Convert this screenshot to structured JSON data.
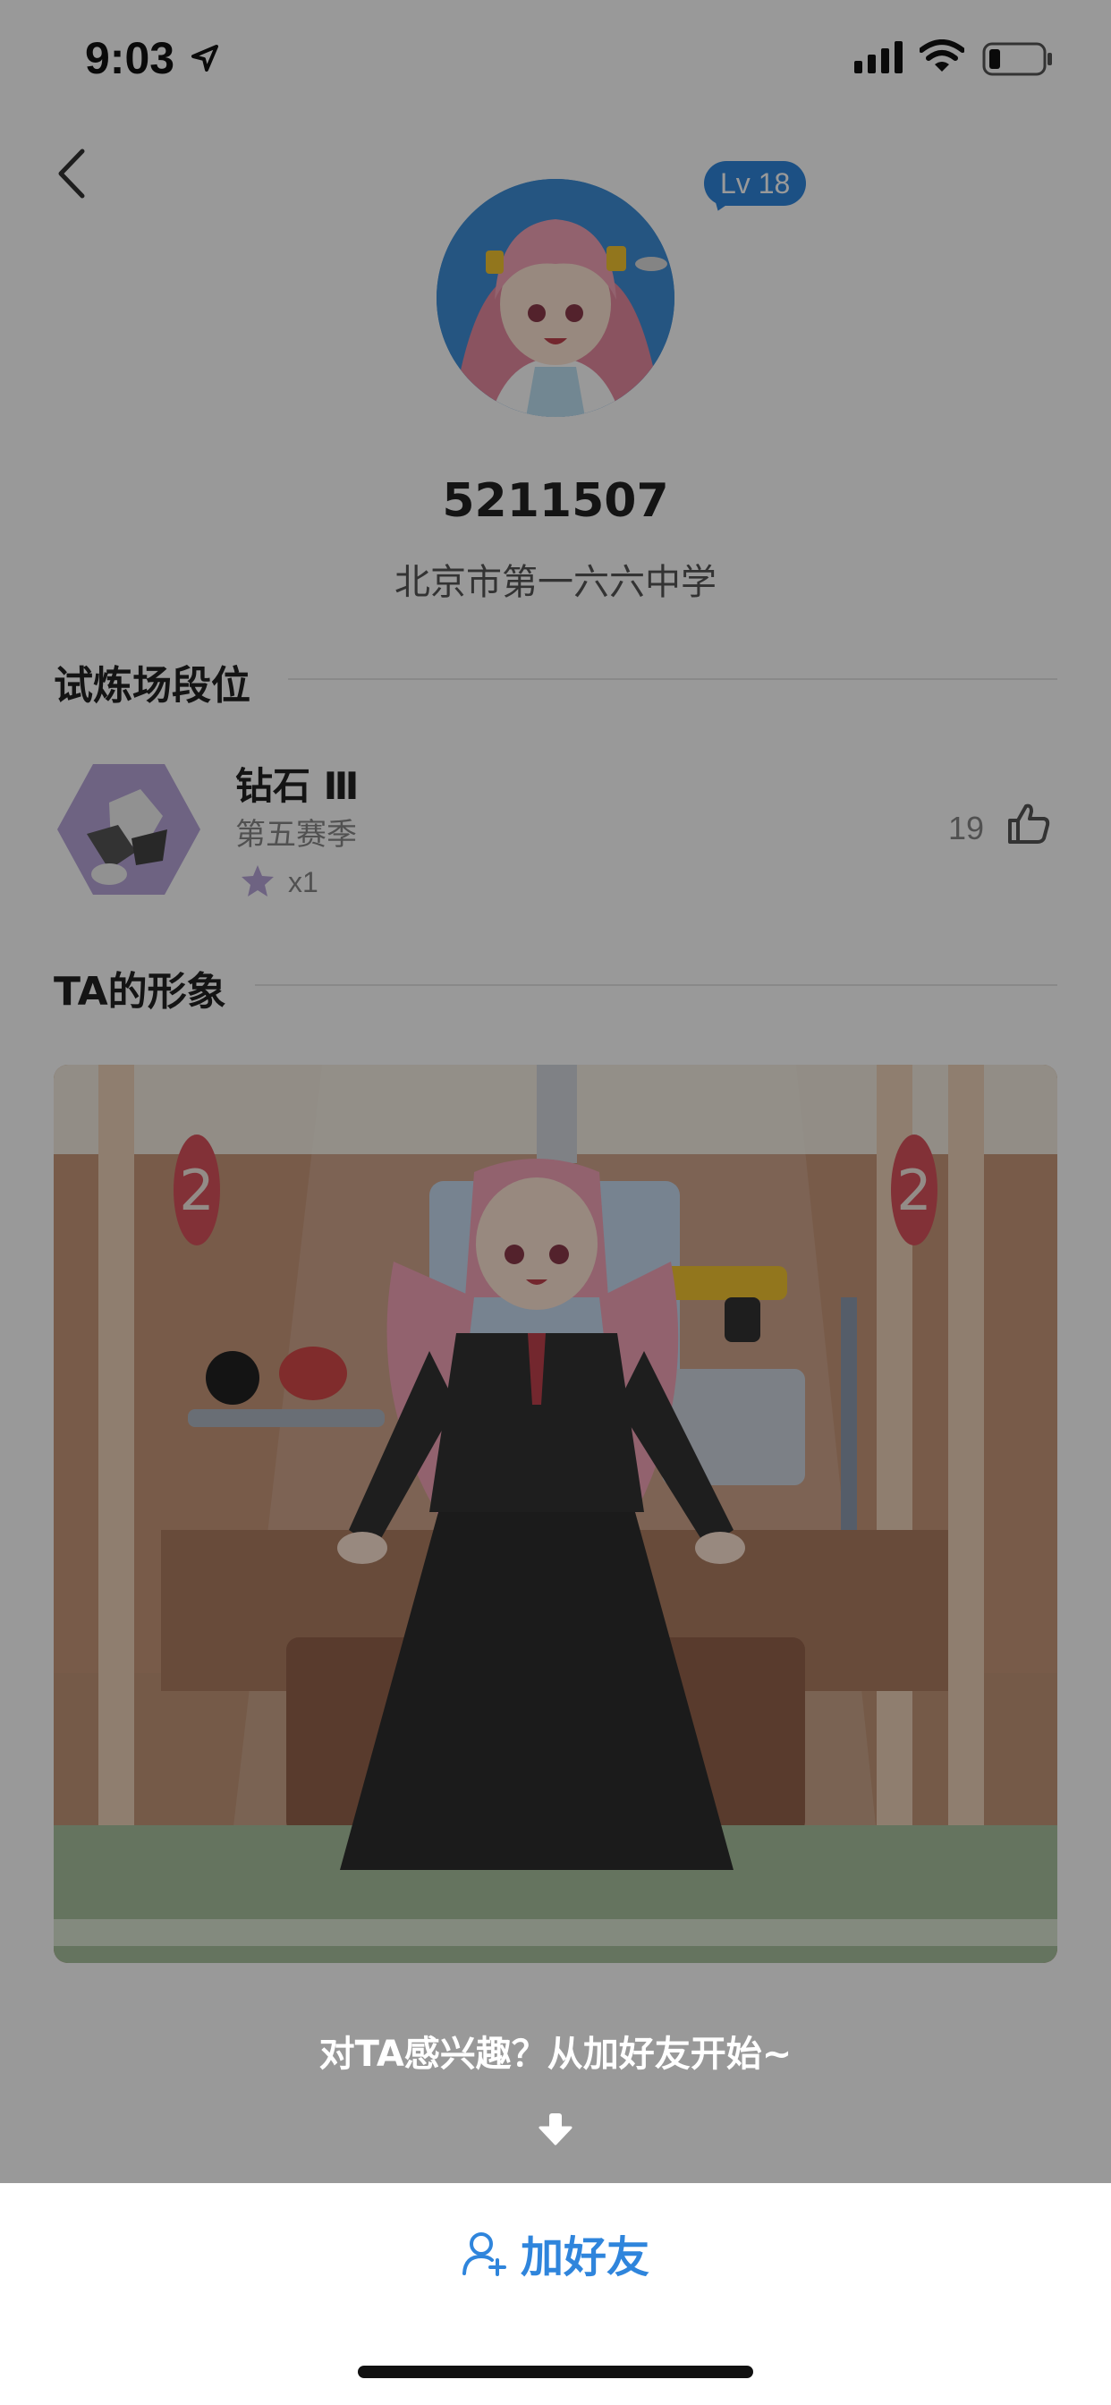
{
  "status_bar": {
    "time": "9:03"
  },
  "profile": {
    "level": "Lv 18",
    "uid": "5211507",
    "school": "北京市第一六六中学"
  },
  "rank_section": {
    "title": "试炼场段位",
    "rank_name": "钻石 Ⅲ",
    "season": "第五赛季",
    "stars": "x1",
    "likes": "19"
  },
  "image_section": {
    "title": "TA的形象"
  },
  "scene": {
    "target_number": "2"
  },
  "hint": "对TA感兴趣？从加好友开始~",
  "bottom": {
    "add_friend_label": "加好友"
  },
  "colors": {
    "accent": "#2f85dc",
    "overlay": "rgba(0,0,0,0.40)"
  }
}
